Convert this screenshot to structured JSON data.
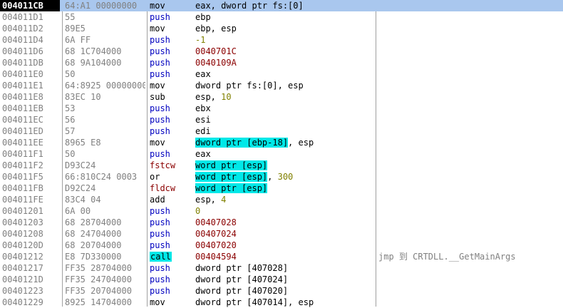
{
  "colors": {
    "selected_row": "#a9c7ee",
    "selected_address_bg": "#000000",
    "address_text": "#808080",
    "push_mnemonic": "#0000c0",
    "fpu_mnemonic": "#8b0000",
    "address_operand": "#8b0000",
    "immediate_operand": "#808000",
    "memory_highlight": "#00e8e8",
    "comment_text": "#808080"
  },
  "disassembly": {
    "rows": [
      {
        "addr": "004011CB",
        "hex": "64:A1 00000000",
        "mn": "mov",
        "mnc": "normal",
        "selected": true,
        "ops": [
          {
            "t": "eax, dword ptr fs:[0]",
            "c": "text"
          }
        ],
        "comment": ""
      },
      {
        "addr": "004011D1",
        "hex": "55",
        "mn": "push",
        "mnc": "push",
        "ops": [
          {
            "t": "ebp",
            "c": "text"
          }
        ],
        "comment": ""
      },
      {
        "addr": "004011D2",
        "hex": "89E5",
        "mn": "mov",
        "mnc": "normal",
        "ops": [
          {
            "t": "ebp, esp",
            "c": "text"
          }
        ],
        "comment": ""
      },
      {
        "addr": "004011D4",
        "hex": "6A FF",
        "mn": "push",
        "mnc": "push",
        "ops": [
          {
            "t": "-1",
            "c": "imm"
          }
        ],
        "comment": ""
      },
      {
        "addr": "004011D6",
        "hex": "68 1C704000",
        "mn": "push",
        "mnc": "push",
        "ops": [
          {
            "t": "0040701C",
            "c": "addr"
          }
        ],
        "comment": ""
      },
      {
        "addr": "004011DB",
        "hex": "68 9A104000",
        "mn": "push",
        "mnc": "push",
        "ops": [
          {
            "t": "0040109A",
            "c": "addr"
          }
        ],
        "comment": ""
      },
      {
        "addr": "004011E0",
        "hex": "50",
        "mn": "push",
        "mnc": "push",
        "ops": [
          {
            "t": "eax",
            "c": "text"
          }
        ],
        "comment": ""
      },
      {
        "addr": "004011E1",
        "hex": "64:8925 00000000",
        "mn": "mov",
        "mnc": "normal",
        "ops": [
          {
            "t": "dword ptr fs:[0], esp",
            "c": "text"
          }
        ],
        "comment": ""
      },
      {
        "addr": "004011E8",
        "hex": "83EC 10",
        "mn": "sub",
        "mnc": "normal",
        "ops": [
          {
            "t": "esp, ",
            "c": "text"
          },
          {
            "t": "10",
            "c": "imm"
          }
        ],
        "comment": ""
      },
      {
        "addr": "004011EB",
        "hex": "53",
        "mn": "push",
        "mnc": "push",
        "ops": [
          {
            "t": "ebx",
            "c": "text"
          }
        ],
        "comment": ""
      },
      {
        "addr": "004011EC",
        "hex": "56",
        "mn": "push",
        "mnc": "push",
        "ops": [
          {
            "t": "esi",
            "c": "text"
          }
        ],
        "comment": ""
      },
      {
        "addr": "004011ED",
        "hex": "57",
        "mn": "push",
        "mnc": "push",
        "ops": [
          {
            "t": "edi",
            "c": "text"
          }
        ],
        "comment": ""
      },
      {
        "addr": "004011EE",
        "hex": "8965 E8",
        "mn": "mov",
        "mnc": "normal",
        "ops": [
          {
            "t": "dword ptr [ebp-18]",
            "c": "mem"
          },
          {
            "t": ", esp",
            "c": "text"
          }
        ],
        "comment": ""
      },
      {
        "addr": "004011F1",
        "hex": "50",
        "mn": "push",
        "mnc": "push",
        "ops": [
          {
            "t": "eax",
            "c": "text"
          }
        ],
        "comment": ""
      },
      {
        "addr": "004011F2",
        "hex": "D93C24",
        "mn": "fstcw",
        "mnc": "fpu",
        "ops": [
          {
            "t": "word ptr [esp]",
            "c": "mem"
          }
        ],
        "comment": ""
      },
      {
        "addr": "004011F5",
        "hex": "66:810C24 0003",
        "mn": "or",
        "mnc": "normal",
        "ops": [
          {
            "t": "word ptr [esp]",
            "c": "mem"
          },
          {
            "t": ", ",
            "c": "text"
          },
          {
            "t": "300",
            "c": "imm"
          }
        ],
        "comment": ""
      },
      {
        "addr": "004011FB",
        "hex": "D92C24",
        "mn": "fldcw",
        "mnc": "fpu",
        "ops": [
          {
            "t": "word ptr [esp]",
            "c": "mem"
          }
        ],
        "comment": ""
      },
      {
        "addr": "004011FE",
        "hex": "83C4 04",
        "mn": "add",
        "mnc": "normal",
        "ops": [
          {
            "t": "esp, ",
            "c": "text"
          },
          {
            "t": "4",
            "c": "imm"
          }
        ],
        "comment": ""
      },
      {
        "addr": "00401201",
        "hex": "6A 00",
        "mn": "push",
        "mnc": "push",
        "ops": [
          {
            "t": "0",
            "c": "imm"
          }
        ],
        "comment": ""
      },
      {
        "addr": "00401203",
        "hex": "68 28704000",
        "mn": "push",
        "mnc": "push",
        "ops": [
          {
            "t": "00407028",
            "c": "addr"
          }
        ],
        "comment": ""
      },
      {
        "addr": "00401208",
        "hex": "68 24704000",
        "mn": "push",
        "mnc": "push",
        "ops": [
          {
            "t": "00407024",
            "c": "addr"
          }
        ],
        "comment": ""
      },
      {
        "addr": "0040120D",
        "hex": "68 20704000",
        "mn": "push",
        "mnc": "push",
        "ops": [
          {
            "t": "00407020",
            "c": "addr"
          }
        ],
        "comment": ""
      },
      {
        "addr": "00401212",
        "hex": "E8 7D330000",
        "mn": "call",
        "mnc": "call",
        "ops": [
          {
            "t": "00404594",
            "c": "addr"
          }
        ],
        "comment": "jmp 到 CRTDLL.__GetMainArgs"
      },
      {
        "addr": "00401217",
        "hex": "FF35 28704000",
        "mn": "push",
        "mnc": "push",
        "ops": [
          {
            "t": "dword ptr [407028]",
            "c": "text"
          }
        ],
        "comment": ""
      },
      {
        "addr": "0040121D",
        "hex": "FF35 24704000",
        "mn": "push",
        "mnc": "push",
        "ops": [
          {
            "t": "dword ptr [407024]",
            "c": "text"
          }
        ],
        "comment": ""
      },
      {
        "addr": "00401223",
        "hex": "FF35 20704000",
        "mn": "push",
        "mnc": "push",
        "ops": [
          {
            "t": "dword ptr [407020]",
            "c": "text"
          }
        ],
        "comment": ""
      },
      {
        "addr": "00401229",
        "hex": "8925 14704000",
        "mn": "mov",
        "mnc": "normal",
        "ops": [
          {
            "t": "dword ptr [407014], esp",
            "c": "text"
          }
        ],
        "comment": ""
      }
    ]
  }
}
